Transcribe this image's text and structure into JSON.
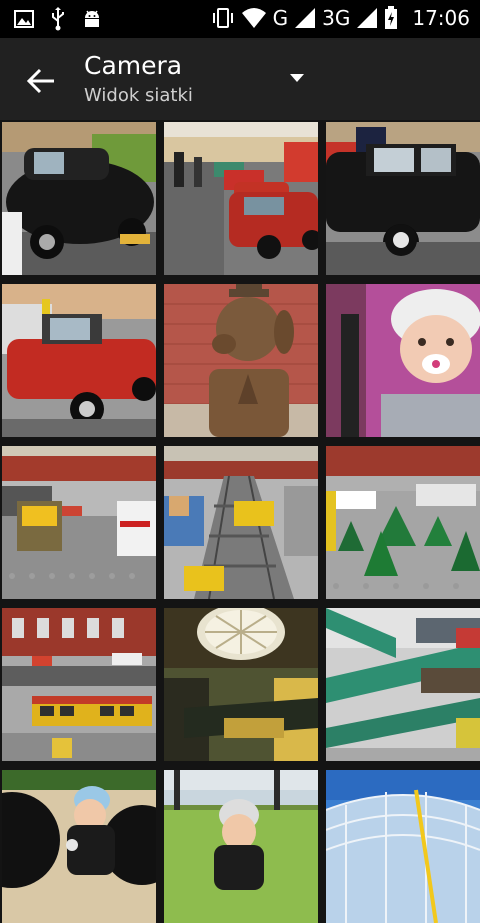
{
  "status_bar": {
    "left_icons": [
      "image-icon",
      "usb-icon",
      "android-icon"
    ],
    "network_g": "G",
    "network_3g": "3G",
    "time": "17:06"
  },
  "app_bar": {
    "title": "Camera",
    "subtitle": "Widok siatki"
  },
  "photos": [
    "photo-black-fiat-126p",
    "photo-row-of-fiats-street",
    "photo-black-fiat-closeup",
    "photo-red-fiat-convertible",
    "photo-dog-statue",
    "photo-baby-in-stroller",
    "photo-lego-city-street",
    "photo-lego-railway",
    "photo-lego-trees",
    "photo-lego-buses",
    "photo-mall-dome",
    "photo-mall-escalators",
    "photo-child-on-tire",
    "photo-child-in-park",
    "photo-glass-roof"
  ],
  "colors": {
    "status_bar_bg": "#000000",
    "app_bar_bg": "#212121",
    "grid_bg": "#141414"
  }
}
